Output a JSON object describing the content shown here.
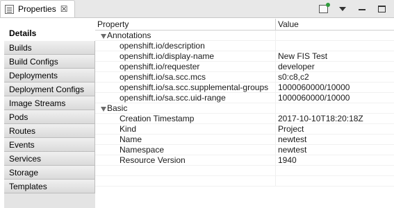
{
  "view": {
    "title": "Properties",
    "close_glyph": "☒",
    "toolbar": [
      {
        "name": "pin-icon"
      },
      {
        "name": "view-menu-icon"
      },
      {
        "name": "minimize-icon"
      },
      {
        "name": "maximize-icon"
      }
    ]
  },
  "side_tabs": [
    {
      "label": "Details",
      "active": true
    },
    {
      "label": "Builds"
    },
    {
      "label": "Build Configs"
    },
    {
      "label": "Deployments"
    },
    {
      "label": "Deployment Configs"
    },
    {
      "label": "Image Streams"
    },
    {
      "label": "Pods"
    },
    {
      "label": "Routes"
    },
    {
      "label": "Events"
    },
    {
      "label": "Services"
    },
    {
      "label": "Storage"
    },
    {
      "label": "Templates"
    }
  ],
  "table": {
    "headers": {
      "property": "Property",
      "value": "Value"
    },
    "rows": [
      {
        "kind": "category",
        "property": "Annotations",
        "value": ""
      },
      {
        "kind": "leaf",
        "property": "openshift.io/description",
        "value": ""
      },
      {
        "kind": "leaf",
        "property": "openshift.io/display-name",
        "value": "New FIS Test"
      },
      {
        "kind": "leaf",
        "property": "openshift.io/requester",
        "value": "developer"
      },
      {
        "kind": "leaf",
        "property": "openshift.io/sa.scc.mcs",
        "value": "s0:c8,c2"
      },
      {
        "kind": "leaf",
        "property": "openshift.io/sa.scc.supplemental-groups",
        "value": "1000060000/10000"
      },
      {
        "kind": "leaf",
        "property": "openshift.io/sa.scc.uid-range",
        "value": "1000060000/10000"
      },
      {
        "kind": "category",
        "property": "Basic",
        "value": ""
      },
      {
        "kind": "leaf",
        "property": "Creation Timestamp",
        "value": "2017-10-10T18:20:18Z"
      },
      {
        "kind": "leaf",
        "property": "Kind",
        "value": "Project"
      },
      {
        "kind": "leaf",
        "property": "Name",
        "value": "newtest"
      },
      {
        "kind": "leaf",
        "property": "Namespace",
        "value": "newtest"
      },
      {
        "kind": "leaf",
        "property": "Resource Version",
        "value": "1940"
      }
    ]
  }
}
